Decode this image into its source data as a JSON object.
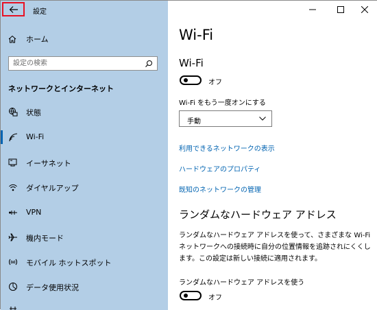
{
  "window": {
    "title": "設定",
    "controls": [
      "minimize",
      "maximize",
      "close"
    ]
  },
  "sidebar": {
    "home_label": "ホーム",
    "search_placeholder": "設定の検索",
    "section_title": "ネットワークとインターネット",
    "items": [
      {
        "label": "状態",
        "icon": "status-globe-icon",
        "selected": false
      },
      {
        "label": "Wi-Fi",
        "icon": "wifi-icon",
        "selected": true
      },
      {
        "label": "イーサネット",
        "icon": "ethernet-icon",
        "selected": false
      },
      {
        "label": "ダイヤルアップ",
        "icon": "dialup-icon",
        "selected": false
      },
      {
        "label": "VPN",
        "icon": "vpn-icon",
        "selected": false
      },
      {
        "label": "機内モード",
        "icon": "airplane-icon",
        "selected": false
      },
      {
        "label": "モバイル ホットスポット",
        "icon": "hotspot-icon",
        "selected": false
      },
      {
        "label": "データ使用状況",
        "icon": "data-usage-icon",
        "selected": false
      }
    ]
  },
  "main": {
    "page_title": "Wi-Fi",
    "wifi_section_title": "Wi-Fi",
    "wifi_toggle_state": "オフ",
    "reenable_label": "Wi-Fi をもう一度オンにする",
    "reenable_selected": "手動",
    "links": [
      "利用できるネットワークの表示",
      "ハードウェアのプロパティ",
      "既知のネットワークの管理"
    ],
    "random_section_title": "ランダムなハードウェア アドレス",
    "random_description": "ランダムなハードウェア アドレスを使って、さまざまな Wi-Fi ネットワークへの接続時に自分の位置情報を追跡されにくくします。この設定は新しい接続に適用されます。",
    "random_use_label": "ランダムなハードウェア アドレスを使う",
    "random_toggle_state": "オフ"
  },
  "colors": {
    "sidebar_bg": "#b3cee6",
    "accent": "#0063b1",
    "back_highlight": "#e81123"
  }
}
